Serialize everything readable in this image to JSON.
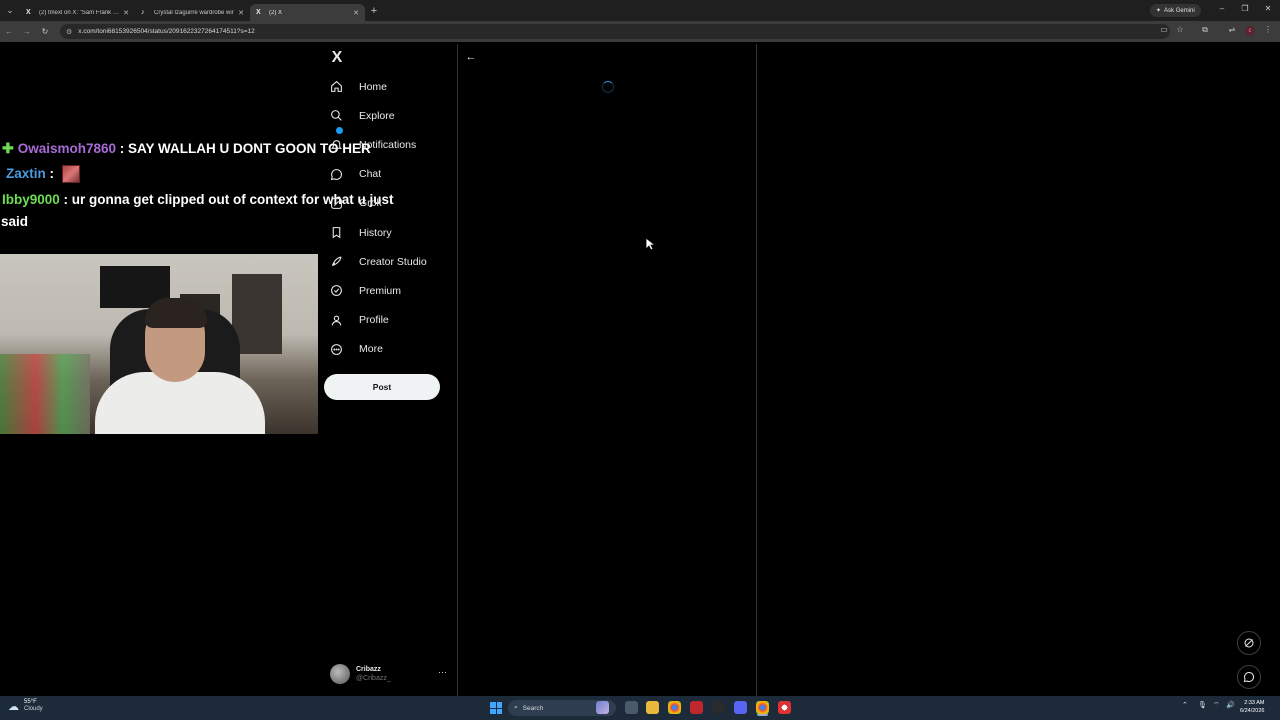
{
  "browser": {
    "tabs": [
      {
        "favicon": "X",
        "title": "(2) tmexl on X: \"Sam Frank REF"
      },
      {
        "favicon": "♪",
        "title": "Crystal Izaguirre wardrobe wir"
      },
      {
        "favicon": "X",
        "title": "(2) X"
      }
    ],
    "new_tab": "+",
    "ask_gemini": "Ask Gemini",
    "url": "x.com/toni68153926504/status/2091622327264174511?s=12"
  },
  "stream_overlay": {
    "chat": [
      {
        "user": "Owaismoh7860",
        "sep": " : ",
        "text": "SAY WALLAH U DONT GOON TO HER"
      },
      {
        "user": "Zaxtin",
        "sep": " : ",
        "text": ""
      },
      {
        "user": "Ibby9000",
        "sep": " : ",
        "text": "ur gonna get clipped out of context for what u just"
      },
      {
        "user": "",
        "sep": "",
        "text": "said"
      }
    ]
  },
  "x": {
    "logo": "X",
    "nav": [
      {
        "icon": "home-icon",
        "label": "Home"
      },
      {
        "icon": "search-icon",
        "label": "Explore"
      },
      {
        "icon": "bell-icon",
        "label": "Notifications"
      },
      {
        "icon": "chat-icon",
        "label": "Chat"
      },
      {
        "icon": "grok-icon",
        "label": "Grok"
      },
      {
        "icon": "bookmark-icon",
        "label": "History"
      },
      {
        "icon": "rocket-icon",
        "label": "Creator Studio"
      },
      {
        "icon": "verified-icon",
        "label": "Premium"
      },
      {
        "icon": "person-icon",
        "label": "Profile"
      },
      {
        "icon": "more-circle-icon",
        "label": "More"
      }
    ],
    "post_label": "Post",
    "account": {
      "name": "Cribazz",
      "handle": "@Cribazz_",
      "more": "···"
    },
    "back": "←"
  },
  "taskbar": {
    "weather": {
      "temp": "55°F",
      "condition": "Cloudy"
    },
    "search": "Search",
    "time": "2:33 AM",
    "date": "6/24/2026"
  }
}
